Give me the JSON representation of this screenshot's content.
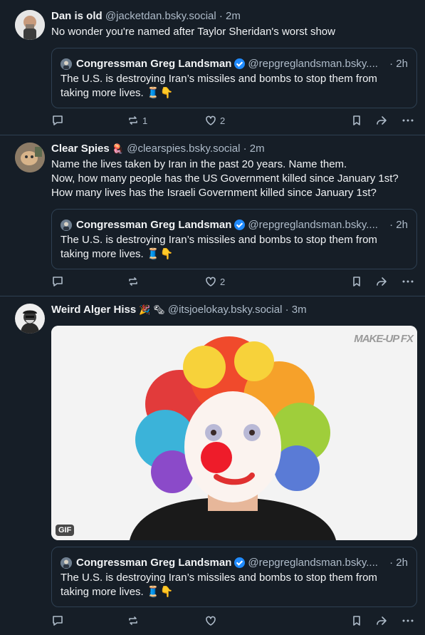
{
  "posts": [
    {
      "author_name": "Dan is old",
      "handle": "@jacketdan.bsky.social",
      "time": "· 2m",
      "text_lines": [
        "No wonder you're named after Taylor Sheridan's worst show"
      ],
      "quote": {
        "author_name": "Congressman Greg Landsman",
        "handle": "@repgreglandsman.bsky....",
        "time": "· 2h",
        "text_lines": [
          "The U.S. is destroying Iran’s missiles and bombs to stop them from",
          "taking more lives. 🧵👇"
        ]
      },
      "repost_count": "1",
      "like_count": "2"
    },
    {
      "author_name": "Clear Spies",
      "name_emoji": "🪼",
      "handle": "@clearspies.bsky.social",
      "time": "· 2m",
      "text_lines": [
        "Name the lives taken by Iran in the past 20 years. Name them.",
        "Now, how many people has the US Government killed since January 1st?",
        "How many lives has the Israeli Government killed since January 1st?"
      ],
      "quote": {
        "author_name": "Congressman Greg Landsman",
        "handle": "@repgreglandsman.bsky....",
        "time": "· 2h",
        "text_lines": [
          "The U.S. is destroying Iran’s missiles and bombs to stop them from",
          "taking more lives. 🧵👇"
        ]
      },
      "repost_count": "",
      "like_count": "2"
    },
    {
      "author_name": "Weird Alger Hiss",
      "name_emoji": "🎉 🗞",
      "handle": "@itsjoelokay.bsky.social",
      "time": "· 3m",
      "gif_badge": "GIF",
      "gif_watermark": "MAKE-UP FX",
      "quote": {
        "author_name": "Congressman Greg Landsman",
        "handle": "@repgreglandsman.bsky....",
        "time": "· 2h",
        "text_lines": [
          "The U.S. is destroying Iran’s missiles and bombs to stop them from",
          "taking more lives. 🧵👇"
        ]
      },
      "repost_count": "",
      "like_count": ""
    }
  ],
  "colors": {
    "background": "#161e27",
    "border": "#2e4052",
    "muted_text": "#aebbc9",
    "verified_badge": "#208bfe"
  }
}
